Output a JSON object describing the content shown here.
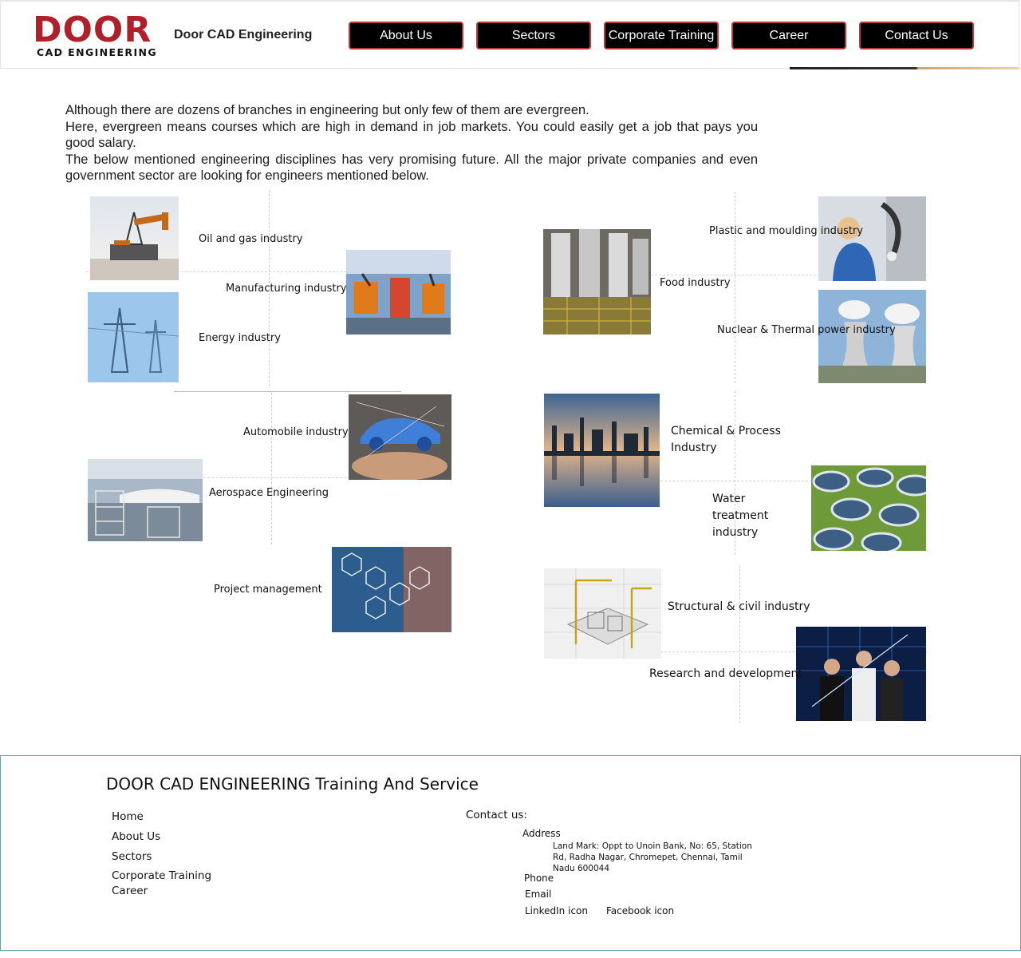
{
  "header": {
    "logo_main": "DOOR",
    "logo_sub": "CAD  ENGINEERING",
    "site_name": "Door CAD Engineering",
    "nav": [
      "About Us",
      "Sectors",
      "Corporate Training",
      "Career",
      "Contact Us"
    ]
  },
  "intro": {
    "line1": "Although there are dozens of branches in engineering but only few of them are evergreen.",
    "line2": "Here, evergreen means courses which are high in demand in job markets. You could easily get a job that pays you good salary.",
    "line3": "The below mentioned engineering disciplines has very promising future. All the major private companies and even government sector are looking for engineers mentioned below."
  },
  "sectors": {
    "oil_gas": "Oil and gas industry",
    "manufacturing": "Manufacturing industry",
    "energy": "Energy industry",
    "automobile": "Automobile industry",
    "aerospace": "Aerospace Engineering",
    "project": "Project management",
    "plastic": "Plastic and moulding industry",
    "food": "Food industry",
    "nuclear": "Nuclear & Thermal power industry",
    "chemical": "Chemical & Process Industry",
    "water": "Water treatment industry",
    "structural": "Structural & civil industry",
    "research": "Research and development"
  },
  "footer": {
    "title": "DOOR CAD ENGINEERING Training And Service",
    "links": [
      "Home",
      "About Us",
      "Sectors",
      "Corporate Training",
      "Career"
    ],
    "contact_heading": "Contact us:",
    "address_label": "Address",
    "address_text": "Land Mark: Oppt to Unoin Bank, No: 65, Station Rd, Radha Nagar, Chromepet, Chennai, Tamil Nadu 600044",
    "phone_label": "Phone",
    "email_label": "Email",
    "linkedin": "LinkedIn icon",
    "facebook": "Facebook icon"
  },
  "colors": {
    "brand_red": "#b0202a",
    "nav_bg": "#000000",
    "nav_border": "#b23a3a",
    "footer_border": "#6aa0a8"
  }
}
